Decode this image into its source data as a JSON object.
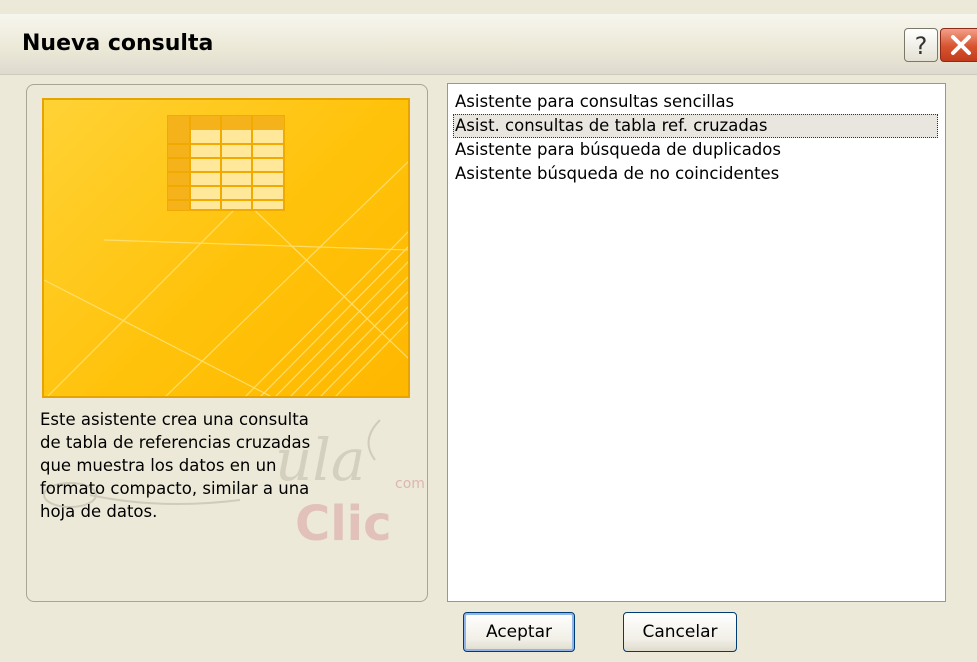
{
  "window": {
    "title": "Nueva consulta",
    "help_label": "?",
    "close_icon": "close-icon"
  },
  "description": {
    "lines": [
      "Este asistente crea una consulta",
      "de tabla de referencias cruzadas",
      "que muestra los datos en un",
      "formato compacto, similar a una",
      "hoja de datos."
    ]
  },
  "wizards": {
    "items": [
      {
        "label": "Asistente para consultas sencillas",
        "selected": false
      },
      {
        "label": "Asist. consultas de tabla ref. cruzadas",
        "selected": true
      },
      {
        "label": "Asistente para búsqueda de duplicados",
        "selected": false
      },
      {
        "label": "Asistente búsqueda de no coincidentes",
        "selected": false
      }
    ]
  },
  "buttons": {
    "ok_label": "Aceptar",
    "cancel_label": "Cancelar"
  },
  "colors": {
    "preview_background": "#ffc20a",
    "dialog_background": "#ece9d8",
    "close_button": "#d8532f"
  },
  "watermark": {
    "text": "aula Clic .com"
  }
}
